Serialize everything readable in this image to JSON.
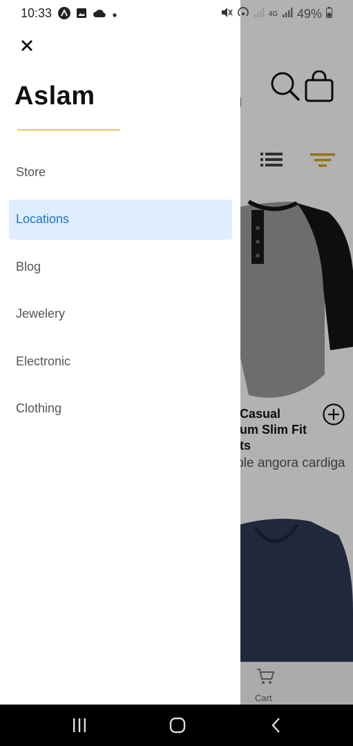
{
  "status_bar": {
    "time": "10:33",
    "battery": "49%",
    "icons_left": [
      "alert-a-icon",
      "image-icon",
      "cloud-icon",
      "dot-icon"
    ],
    "icons_right": [
      "mute-icon",
      "hotspot-icon",
      "signal-icon",
      "lte-signal-icon",
      "battery-icon"
    ],
    "network_label": "4G"
  },
  "drawer": {
    "title": "Aslam",
    "accent_color": "#e2c268",
    "items": [
      {
        "label": "Store",
        "active": false
      },
      {
        "label": "Locations",
        "active": true
      },
      {
        "label": "Blog",
        "active": false
      },
      {
        "label": "Jewelery",
        "active": false
      },
      {
        "label": "Electronic",
        "active": false
      },
      {
        "label": "Clothing",
        "active": false
      }
    ]
  },
  "background": {
    "brand_tail": "n",
    "product": {
      "title": "Casual\num Slim Fit\nts",
      "description": "ible angora cardiga"
    },
    "bottom_nav": {
      "cart_label": "Cart"
    },
    "filter_color": "#d9a21b"
  },
  "system_nav": {
    "buttons": [
      "recents-icon",
      "home-icon",
      "back-icon"
    ]
  }
}
